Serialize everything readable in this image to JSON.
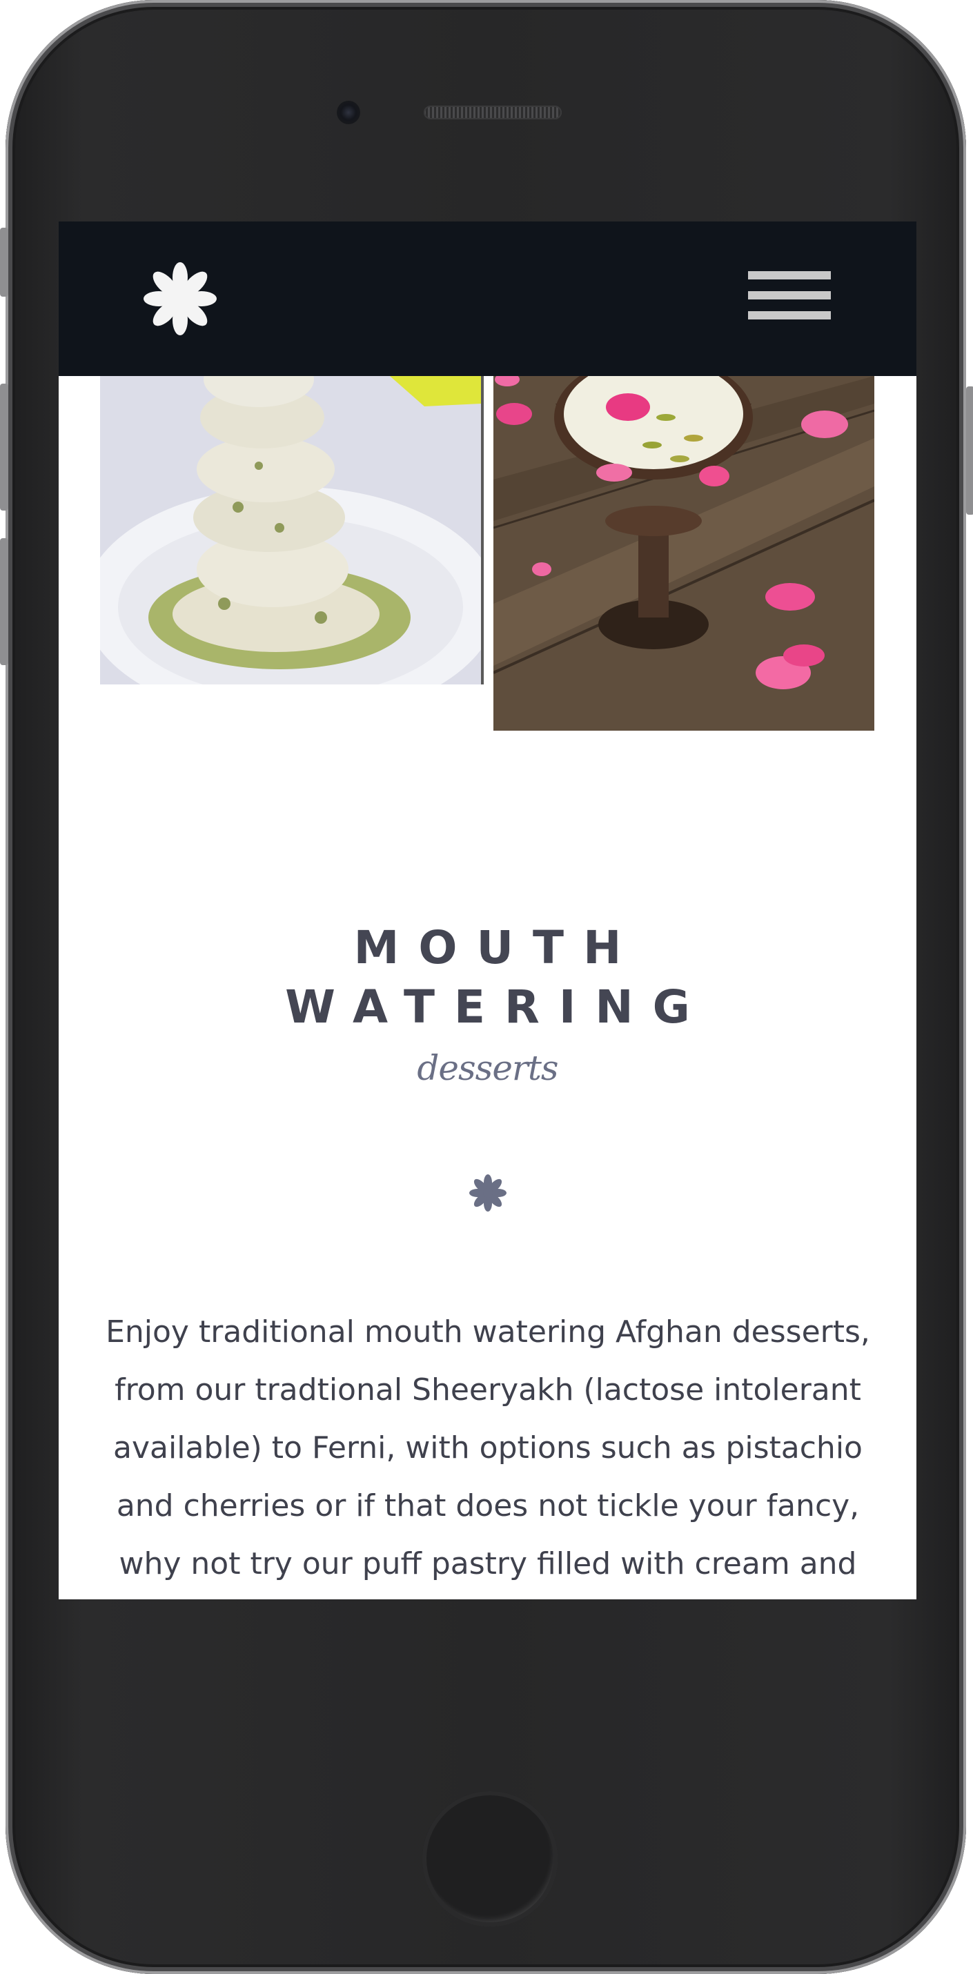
{
  "header": {
    "logo_icon": "asterisk-flower-icon",
    "menu_icon": "hamburger-menu-icon"
  },
  "gallery": {
    "images": [
      {
        "name": "pistachio-ice-cream-dessert-image"
      },
      {
        "name": "ferni-with-rose-petals-image"
      }
    ]
  },
  "section": {
    "title_line1": "MOUTH",
    "title_line2": "WATERING",
    "subtitle": "desserts",
    "divider_icon": "asterisk-icon",
    "description": "Enjoy traditional mouth watering Afghan desserts, from our tradtional Sheeryakh (lactose intolerant available) to Ferni, with options such as pistachio and cherries or if that does not tickle your fancy, why not try our puff pastry filled with cream and topped up with? Go on give it a try, you know you want to!"
  },
  "colors": {
    "navbar_bg": "#0f141b",
    "heading": "#444653",
    "accent": "#6a6f85"
  }
}
